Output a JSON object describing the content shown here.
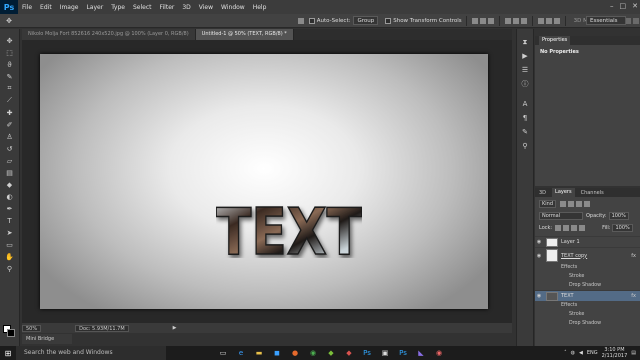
{
  "app": {
    "logo": "Ps"
  },
  "menu": [
    "File",
    "Edit",
    "Image",
    "Layer",
    "Type",
    "Select",
    "Filter",
    "3D",
    "View",
    "Window",
    "Help"
  ],
  "window_controls": [
    "–",
    "□",
    "✕"
  ],
  "options": {
    "auto_select_label": "Auto-Select:",
    "auto_select_value": "Group",
    "transform_label": "Show Transform Controls",
    "mode_3d_label": "3D Mode:",
    "workspace": "Essentials"
  },
  "tabs": [
    {
      "label": "Nikolo Molja Fort 852616 240x520.jpg @ 100% (Layer 0, RGB/8)"
    },
    {
      "label": "Untitled-1 @ 50% (TEXT, RGB/8) *"
    }
  ],
  "canvas": {
    "text": "TEXT"
  },
  "status": {
    "zoom": "50%",
    "doc": "Doc: 5.93M/11.7M"
  },
  "minibridge_label": "Mini Bridge",
  "properties": {
    "tab1": "Properties",
    "subtitle": "No Properties"
  },
  "layers_panel": {
    "tab1": "3D",
    "tab2": "Layers",
    "tab3": "Channels",
    "filter_kind": "Kind",
    "blend_mode": "Normal",
    "opacity_label": "Opacity:",
    "opacity_value": "100%",
    "lock_label": "Lock:",
    "fill_label": "Fill:",
    "fill_value": "100%",
    "layers": [
      {
        "name": "Layer 1"
      },
      {
        "name": "TEXT copy"
      },
      {
        "name": "TEXT"
      }
    ],
    "effects_label": "Effects",
    "stroke_label": "Stroke",
    "shadow_label": "Drop Shadow"
  },
  "taskbar": {
    "search": "Search the web and Windows",
    "lang": "ENG",
    "time": "3:10 PM",
    "date": "2/11/2017"
  },
  "colors": {
    "photoshop_blue": "#31a8ff",
    "selection": "#536b86"
  }
}
